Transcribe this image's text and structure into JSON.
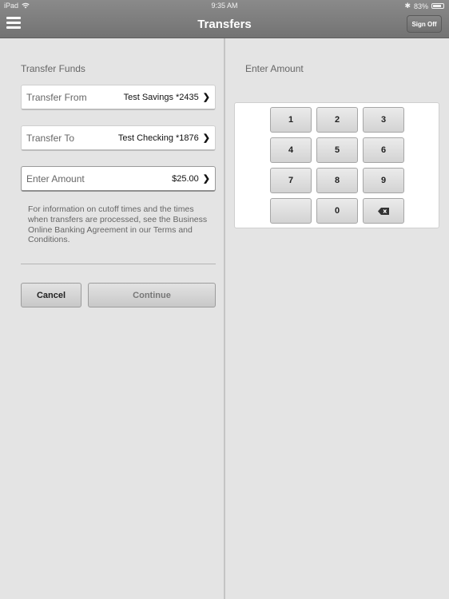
{
  "status_bar": {
    "device": "iPad",
    "time": "9:35 AM",
    "battery_percent": "83%",
    "battery_level": 0.83
  },
  "nav": {
    "title": "Transfers",
    "sign_off_label": "Sign Off"
  },
  "left_pane": {
    "section_title": "Transfer Funds",
    "rows": [
      {
        "label": "Transfer From",
        "value": "Test Savings *2435"
      },
      {
        "label": "Transfer To",
        "value": "Test Checking *1876"
      },
      {
        "label": "Enter Amount",
        "value": "$25.00"
      }
    ],
    "info_text": "For information on cutoff times and the times when transfers are processed, see the Business Online Banking Agreement in our Terms and Conditions.",
    "cancel_label": "Cancel",
    "continue_label": "Continue"
  },
  "right_pane": {
    "section_title": "Enter Amount",
    "keys": [
      "1",
      "2",
      "3",
      "4",
      "5",
      "6",
      "7",
      "8",
      "9",
      "",
      "0",
      "backspace"
    ]
  },
  "colors": {
    "nav_bar": "#7d7d7d",
    "background": "#e4e4e4",
    "disabled_text": "#777777"
  }
}
